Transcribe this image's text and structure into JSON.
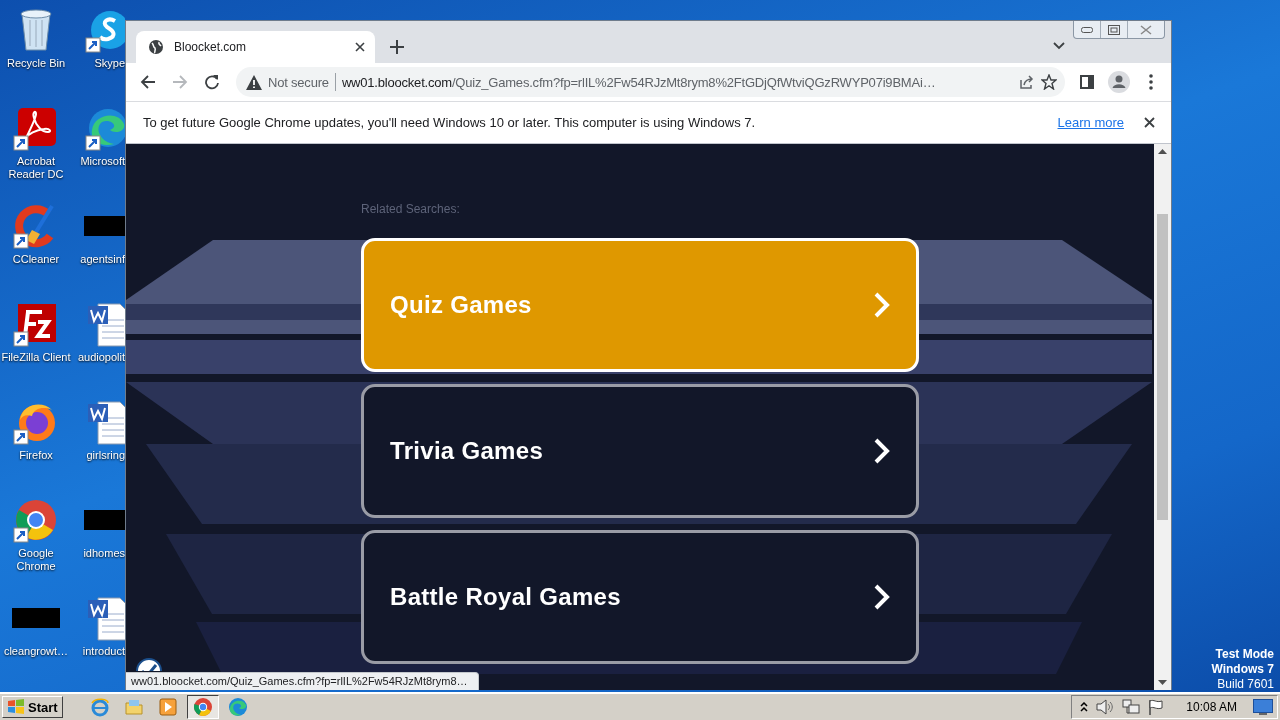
{
  "desktop": {
    "icons": [
      {
        "label": "Recycle Bin",
        "kind": "recycle",
        "shortcut": false
      },
      {
        "label": "Skype",
        "kind": "skype",
        "shortcut": true
      },
      {
        "label": "Acrobat Reader DC",
        "kind": "acrobat",
        "shortcut": true
      },
      {
        "label": "Microsoft",
        "kind": "edge",
        "shortcut": true
      },
      {
        "label": "CCleaner",
        "kind": "ccleaner",
        "shortcut": true
      },
      {
        "label": "agentsinf",
        "kind": "redacted",
        "shortcut": false
      },
      {
        "label": "FileZilla Client",
        "kind": "filezilla",
        "shortcut": true
      },
      {
        "label": "audiopolit",
        "kind": "word",
        "shortcut": false
      },
      {
        "label": "Firefox",
        "kind": "firefox",
        "shortcut": true
      },
      {
        "label": "girlsring",
        "kind": "word",
        "shortcut": false
      },
      {
        "label": "Google Chrome",
        "kind": "chrome",
        "shortcut": true
      },
      {
        "label": "idhomes",
        "kind": "redacted",
        "shortcut": false
      },
      {
        "label": "cleangrowt…",
        "kind": "redacted",
        "shortcut": false
      },
      {
        "label": "introduct",
        "kind": "word",
        "shortcut": false
      }
    ],
    "os_notice": [
      "Test Mode",
      "Windows 7",
      "Build 7601"
    ]
  },
  "browser": {
    "tabs": [
      {
        "title": "Bloocket.com",
        "selected": true
      }
    ],
    "forward_disabled": true,
    "address": {
      "security": "Not secure",
      "host": "ww01.bloocket.com",
      "path": "/Quiz_Games.cfm?fp=rlIL%2Fw54RJzMt8rym8%2FtGDjQfWtviQGzRWYP07i9BMAi…"
    },
    "infobar": {
      "message": "To get future Google Chrome updates, you'll need Windows 10 or later. This computer is using Windows 7.",
      "link": "Learn more"
    },
    "page": {
      "heading": "Related Searches:",
      "links": [
        {
          "label": "Quiz Games",
          "selected": true
        },
        {
          "label": "Trivia Games",
          "selected": false
        },
        {
          "label": "Battle Royal Games",
          "selected": false
        }
      ]
    },
    "status_url": "ww01.bloocket.com/Quiz_Games.cfm?fp=rlIL%2Fw54RJzMt8rym8…"
  },
  "taskbar": {
    "start": "Start",
    "apps": [
      {
        "kind": "ie",
        "active": false
      },
      {
        "kind": "explorer",
        "active": false
      },
      {
        "kind": "media",
        "active": false
      },
      {
        "kind": "chrome",
        "active": true
      },
      {
        "kind": "edge",
        "active": false
      }
    ],
    "clock": "10:08 AM"
  }
}
